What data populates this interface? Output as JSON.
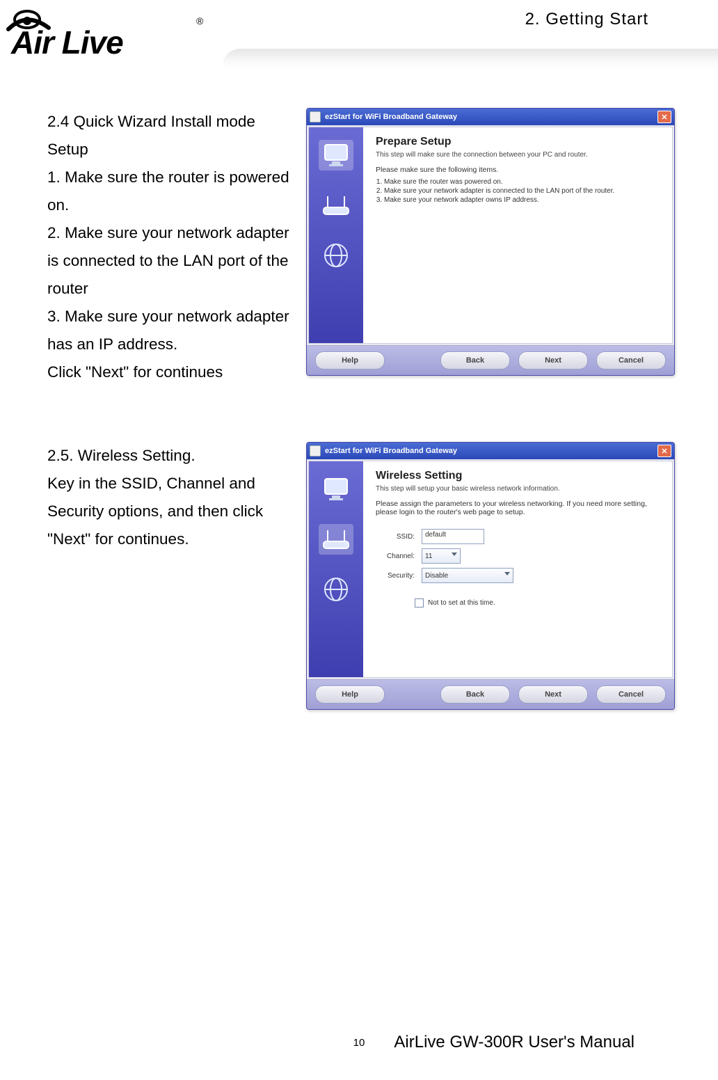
{
  "header": {
    "chapter": "2. Getting Start",
    "logo_text": "Air Live",
    "logo_reg": "®"
  },
  "section24": {
    "heading": "2.4  Quick Wizard Install mode Setup",
    "line1": "1. Make sure the router is powered on.",
    "line2": "2. Make sure your network adapter is connected to the LAN port of the router",
    "line3": "3. Make sure your network adapter has an IP address.",
    "line4": "Click \"Next\" for continues"
  },
  "wiz1": {
    "title": "ezStart for WiFi Broadband Gateway",
    "h1": "Prepare Setup",
    "sub": "This step will make sure the connection between your PC and router.",
    "p1": "Please make sure the following items.",
    "li1": "Make sure the router was powered on.",
    "li2": "Make sure your network adapter is connected to the LAN port of the router.",
    "li3": "Make sure your network adapter owns IP address.",
    "btn_help": "Help",
    "btn_back": "Back",
    "btn_next": "Next",
    "btn_cancel": "Cancel"
  },
  "section25": {
    "heading": "2.5.  Wireless Setting.",
    "line1": "Key in the SSID, Channel and Security options, and then click \"Next\" for continues."
  },
  "wiz2": {
    "title": "ezStart for WiFi Broadband Gateway",
    "h1": "Wireless Setting",
    "sub": "This step will setup your basic wireless network information.",
    "p1": "Please assign the parameters to your wireless networking. If you need more setting, please login to the router's web page to setup.",
    "lbl_ssid": "SSID:",
    "val_ssid": "default",
    "lbl_channel": "Channel:",
    "val_channel": "11",
    "lbl_security": "Security:",
    "val_security": "Disable",
    "chk_label": "Not to set at this time.",
    "btn_help": "Help",
    "btn_back": "Back",
    "btn_next": "Next",
    "btn_cancel": "Cancel"
  },
  "footer": {
    "page_number": "10",
    "manual_name": "AirLive GW-300R User's Manual"
  }
}
